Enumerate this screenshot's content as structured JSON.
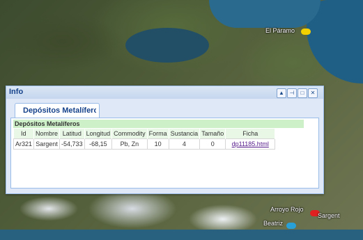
{
  "map": {
    "labels": {
      "el_paramo": "El Páramo",
      "arroyo_rojo": "Arroyo Rojo",
      "sargent": "Sargent",
      "beatriz": "Beatriz"
    },
    "colors": {
      "sea": "#1f5f86",
      "pin_yellow": "#f2d000",
      "pin_red": "#e02020",
      "pin_blue": "#28a0d8"
    }
  },
  "info_window": {
    "title": "Info",
    "tools": [
      "up-icon",
      "pin-icon",
      "maximize-icon",
      "close-icon"
    ],
    "tab_label": "Depósitos Metalíferos",
    "panel_heading": "Depósitos Metalíferos",
    "table": {
      "headers": [
        "Id",
        "Nombre",
        "Latitud",
        "Longitud",
        "Commodity",
        "Forma",
        "Sustancia",
        "Tamaño",
        "Ficha"
      ],
      "rows": [
        [
          "Ar321",
          "Sargent",
          "-54,733",
          "-68,15",
          "Pb, Zn",
          "10",
          "4",
          "0",
          "dp11185.html"
        ]
      ]
    }
  }
}
